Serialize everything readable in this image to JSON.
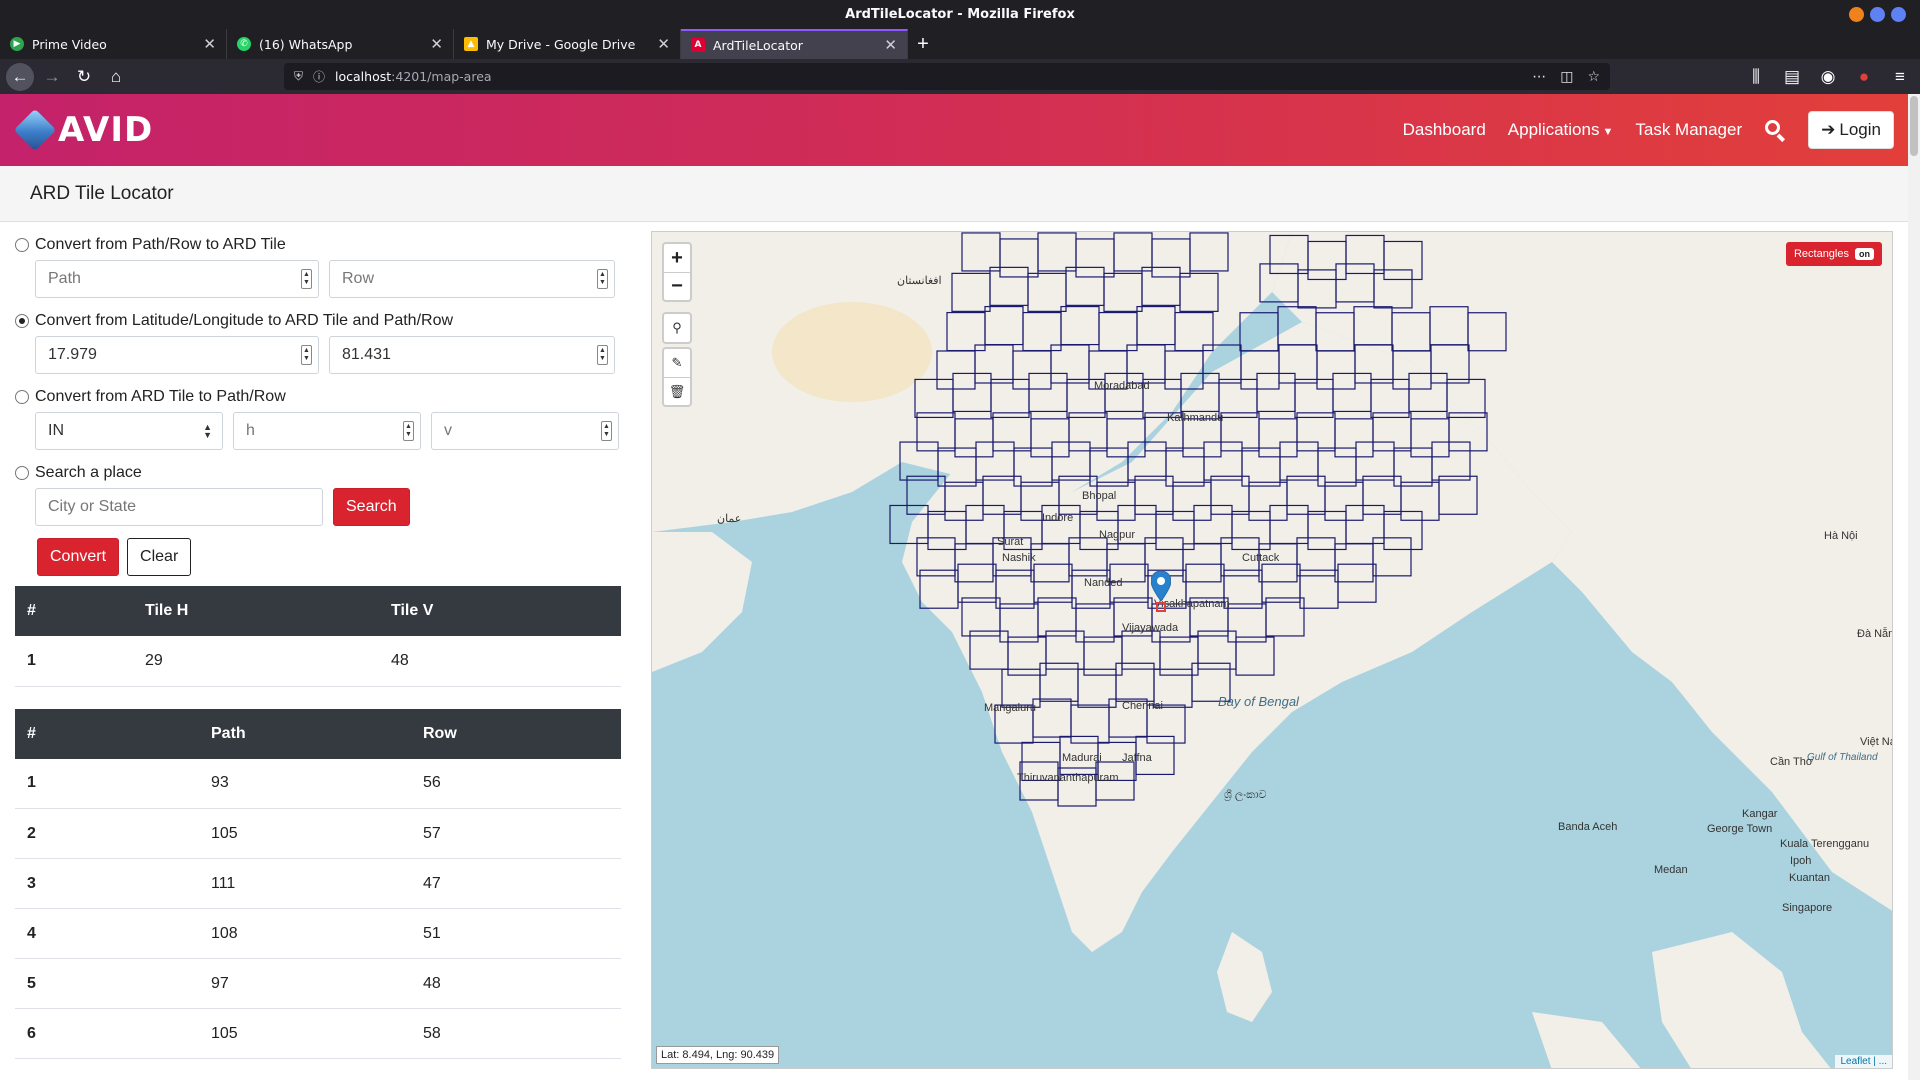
{
  "window": {
    "title": "ArdTileLocator - Mozilla Firefox"
  },
  "tabs": [
    {
      "label": "Prime Video",
      "color": "#2ea44f"
    },
    {
      "label": "(16) WhatsApp",
      "color": "#25d366"
    },
    {
      "label": "My Drive - Google Drive",
      "color": "#fbbc04"
    },
    {
      "label": "ArdTileLocator",
      "color": "#dd0031"
    }
  ],
  "url": {
    "host": "localhost",
    "path": ":4201/map-area"
  },
  "header": {
    "logo": "AVID",
    "nav": {
      "dashboard": "Dashboard",
      "applications": "Applications",
      "task_manager": "Task Manager",
      "login": "Login"
    }
  },
  "page_title": "ARD Tile Locator",
  "options": {
    "path_row": {
      "label": "Convert from Path/Row to ARD Tile",
      "path_placeholder": "Path",
      "row_placeholder": "Row"
    },
    "latlng": {
      "label": "Convert from Latitude/Longitude to ARD Tile and Path/Row",
      "lat_value": "17.979",
      "lng_value": "81.431"
    },
    "ard": {
      "label": "Convert from ARD Tile to Path/Row",
      "region_value": "IN",
      "h_placeholder": "h",
      "v_placeholder": "v"
    },
    "place": {
      "label": "Search a place",
      "placeholder": "City or State",
      "search_label": "Search"
    }
  },
  "actions": {
    "convert": "Convert",
    "clear": "Clear"
  },
  "tile_table": {
    "headers": [
      "#",
      "Tile H",
      "Tile V"
    ],
    "rows": [
      [
        "1",
        "29",
        "48"
      ]
    ]
  },
  "pathrow_table": {
    "headers": [
      "#",
      "Path",
      "Row"
    ],
    "rows": [
      [
        "1",
        "93",
        "56"
      ],
      [
        "2",
        "105",
        "57"
      ],
      [
        "3",
        "111",
        "47"
      ],
      [
        "4",
        "108",
        "51"
      ],
      [
        "5",
        "97",
        "48"
      ],
      [
        "6",
        "105",
        "58"
      ]
    ]
  },
  "map": {
    "rectangles_label": "Rectangles",
    "rectangles_state": "on",
    "coord_readout": "Lat: 8.494, Lng: 90.439",
    "attribution": "Leaflet | ...",
    "labels": {
      "bay": "Bay of Bengal",
      "kathmandu": "Kathmandu",
      "nagpur": "Nagpur",
      "nashik": "Nashik",
      "cuttack": "Cuttack",
      "vijayawada": "Vijayawada",
      "visakhapatnam": "Visakhapatnam",
      "nanded": "Nanded",
      "surat": "Surat",
      "mangaluru": "Mangaluru",
      "chennai": "Chennai",
      "madurai": "Madurai",
      "thiruvananthapuram": "Thiruvananthapuram",
      "jaffna": "Jaffna",
      "moradabad": "Moradabad",
      "indore": "Indore",
      "bhopal": "Bhopal",
      "banda_aceh": "Banda Aceh",
      "george_town": "George Town",
      "kuala_terengganu": "Kuala Terengganu",
      "medan": "Medan",
      "ipoh": "Ipoh",
      "kuantan": "Kuantan",
      "kangar": "Kangar",
      "singapore": "Singapore",
      "gulf_thailand": "Gulf of Thailand",
      "can_tho": "Cần Thơ",
      "ha_noi": "Hà Nội",
      "da_nang": "Đà Nẵng",
      "viet_nam": "Việt Nam",
      "sri_lanka": "ශ්‍රී ලංකාව",
      "afghanistan": "افغانستان",
      "oman": "عمان"
    }
  },
  "colors": {
    "accent": "#d9232e",
    "table_head": "#343a40",
    "tile_stroke": "#1a1a6e",
    "sea": "#aad3df",
    "land": "#f2efe9"
  }
}
